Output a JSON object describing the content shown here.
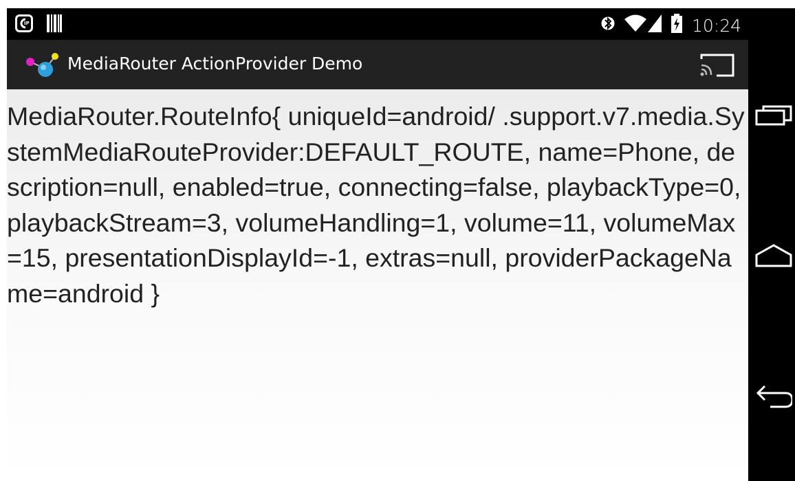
{
  "status_bar": {
    "time": "10:24",
    "icons": [
      "usb-debug-icon",
      "barcode-icon",
      "bluetooth-icon",
      "wifi-icon",
      "cell-signal-icon",
      "battery-charging-icon"
    ]
  },
  "action_bar": {
    "title": "MediaRouter ActionProvider Demo",
    "app_icon": "mediarouter-app-icon",
    "cast_icon": "cast-icon"
  },
  "content": {
    "route_info": "MediaRouter.RouteInfo{ uniqueId=android/ .support.v7.media.SystemMediaRouteProvider:DEFAULT_ROUTE, name=Phone, description=null, enabled=true, connecting=false, playbackType=0, playbackStream=3, volumeHandling=1, volume=11, volumeMax=15, presentationDisplayId=-1, extras=null, providerPackageName=android }"
  },
  "nav_bar": {
    "buttons": [
      "recent-apps-icon",
      "home-icon",
      "back-icon"
    ]
  },
  "colors": {
    "status_bar": "#000000",
    "action_bar": "#222222",
    "content_bg": "#f2f2f2",
    "text": "#222222"
  }
}
